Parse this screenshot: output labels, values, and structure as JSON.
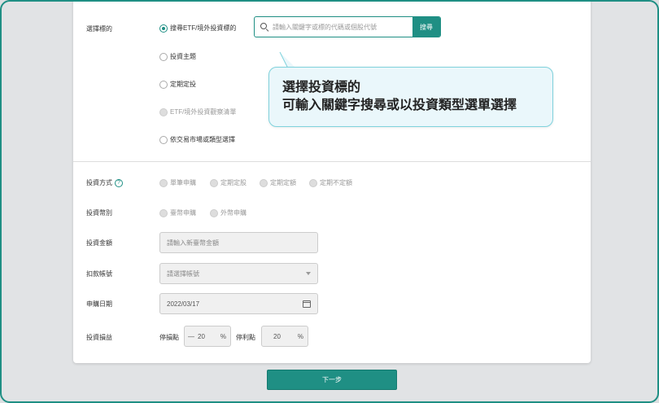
{
  "target": {
    "label": "選擇標的",
    "options": [
      {
        "label": "搜尋ETF/境外投資標的",
        "selected": true,
        "disabled": false
      },
      {
        "label": "投資主題",
        "selected": false,
        "disabled": false
      },
      {
        "label": "定期定投",
        "selected": false,
        "disabled": false
      },
      {
        "label": "ETF/境外投資觀察清單",
        "selected": false,
        "disabled": true
      },
      {
        "label": "依交易市場或類型選擇",
        "selected": false,
        "disabled": false
      }
    ],
    "search_placeholder": "請輸入關鍵字或標的代碼或個股代號",
    "search_button": "搜尋"
  },
  "tooltip": {
    "line1": "選擇投資標的",
    "line2": "可輸入關鍵字搜尋或以投資類型選單選擇"
  },
  "method": {
    "label": "投資方式",
    "help": "?",
    "options": [
      "單筆申購",
      "定期定股",
      "定期定額",
      "定期不定額"
    ]
  },
  "currency": {
    "label": "投資幣別",
    "options": [
      "臺幣申購",
      "外幣申購"
    ]
  },
  "amount": {
    "label": "投資金額",
    "placeholder": "請輸入新臺幣金額"
  },
  "account": {
    "label": "扣款帳號",
    "placeholder": "請選擇帳號"
  },
  "date": {
    "label": "申購日期",
    "value": "2022/03/17"
  },
  "pnl": {
    "label": "投資損益",
    "stop_loss_label": "停損點",
    "stop_loss_sign": "—",
    "stop_loss_value": "20",
    "stop_profit_label": "停利點",
    "stop_profit_value": "20",
    "unit": "%"
  },
  "next_button": "下一步",
  "colors": {
    "accent": "#1f8f84",
    "tooltip_bg": "#eaf7fb",
    "tooltip_border": "#7fd2dc"
  }
}
